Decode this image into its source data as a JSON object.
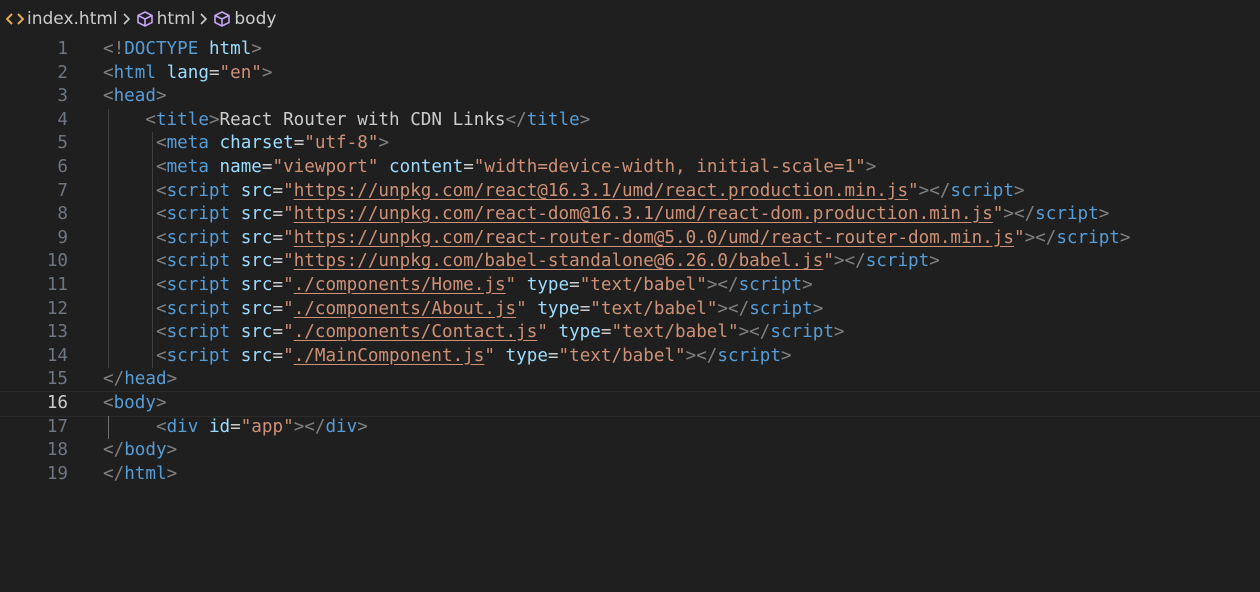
{
  "breadcrumb": {
    "items": [
      {
        "label": "index.html",
        "icon": "code-file-icon"
      },
      {
        "label": "html",
        "icon": "cube-icon"
      },
      {
        "label": "body",
        "icon": "cube-icon"
      }
    ]
  },
  "editor": {
    "active_line": 16,
    "lines": [
      {
        "number": "1",
        "tokens": [
          [
            "p",
            "<!"
          ],
          [
            "t",
            "DOCTYPE"
          ],
          [
            "x",
            " "
          ],
          [
            "a",
            "html"
          ],
          [
            "p",
            ">"
          ]
        ]
      },
      {
        "number": "2",
        "tokens": [
          [
            "p",
            "<"
          ],
          [
            "t",
            "html"
          ],
          [
            "x",
            " "
          ],
          [
            "a",
            "lang"
          ],
          [
            "x",
            "="
          ],
          [
            "s",
            "\"en\""
          ],
          [
            "p",
            ">"
          ]
        ]
      },
      {
        "number": "3",
        "tokens": [
          [
            "p",
            "<"
          ],
          [
            "t",
            "head"
          ],
          [
            "p",
            ">"
          ]
        ]
      },
      {
        "number": "4",
        "tokens": [
          [
            "x",
            "    "
          ],
          [
            "p",
            "<"
          ],
          [
            "t",
            "title"
          ],
          [
            "p",
            ">"
          ],
          [
            "x",
            "React Router with CDN Links"
          ],
          [
            "p",
            "</"
          ],
          [
            "t",
            "title"
          ],
          [
            "p",
            ">"
          ]
        ]
      },
      {
        "number": "5",
        "tokens": [
          [
            "x",
            "     "
          ],
          [
            "p",
            "<"
          ],
          [
            "t",
            "meta"
          ],
          [
            "x",
            " "
          ],
          [
            "a",
            "charset"
          ],
          [
            "x",
            "="
          ],
          [
            "s",
            "\"utf-8\""
          ],
          [
            "p",
            ">"
          ]
        ]
      },
      {
        "number": "6",
        "tokens": [
          [
            "x",
            "     "
          ],
          [
            "p",
            "<"
          ],
          [
            "t",
            "meta"
          ],
          [
            "x",
            " "
          ],
          [
            "a",
            "name"
          ],
          [
            "x",
            "="
          ],
          [
            "s",
            "\"viewport\""
          ],
          [
            "x",
            " "
          ],
          [
            "a",
            "content"
          ],
          [
            "x",
            "="
          ],
          [
            "s",
            "\"width=device-width, initial-scale=1\""
          ],
          [
            "p",
            ">"
          ]
        ]
      },
      {
        "number": "7",
        "tokens": [
          [
            "x",
            "     "
          ],
          [
            "p",
            "<"
          ],
          [
            "t",
            "script"
          ],
          [
            "x",
            " "
          ],
          [
            "a",
            "src"
          ],
          [
            "x",
            "="
          ],
          [
            "s",
            "\""
          ],
          [
            "l",
            "https://unpkg.com/react@16.3.1/umd/react.production.min.js"
          ],
          [
            "s",
            "\""
          ],
          [
            "p",
            "></"
          ],
          [
            "t",
            "script"
          ],
          [
            "p",
            ">"
          ]
        ]
      },
      {
        "number": "8",
        "tokens": [
          [
            "x",
            "     "
          ],
          [
            "p",
            "<"
          ],
          [
            "t",
            "script"
          ],
          [
            "x",
            " "
          ],
          [
            "a",
            "src"
          ],
          [
            "x",
            "="
          ],
          [
            "s",
            "\""
          ],
          [
            "l",
            "https://unpkg.com/react-dom@16.3.1/umd/react-dom.production.min.js"
          ],
          [
            "s",
            "\""
          ],
          [
            "p",
            "></"
          ],
          [
            "t",
            "script"
          ],
          [
            "p",
            ">"
          ]
        ]
      },
      {
        "number": "9",
        "tokens": [
          [
            "x",
            "     "
          ],
          [
            "p",
            "<"
          ],
          [
            "t",
            "script"
          ],
          [
            "x",
            " "
          ],
          [
            "a",
            "src"
          ],
          [
            "x",
            "="
          ],
          [
            "s",
            "\""
          ],
          [
            "l",
            "https://unpkg.com/react-router-dom@5.0.0/umd/react-router-dom.min.js"
          ],
          [
            "s",
            "\""
          ],
          [
            "p",
            "></"
          ],
          [
            "t",
            "script"
          ],
          [
            "p",
            ">"
          ]
        ]
      },
      {
        "number": "10",
        "tokens": [
          [
            "x",
            "     "
          ],
          [
            "p",
            "<"
          ],
          [
            "t",
            "script"
          ],
          [
            "x",
            " "
          ],
          [
            "a",
            "src"
          ],
          [
            "x",
            "="
          ],
          [
            "s",
            "\""
          ],
          [
            "l",
            "https://unpkg.com/babel-standalone@6.26.0/babel.js"
          ],
          [
            "s",
            "\""
          ],
          [
            "p",
            "></"
          ],
          [
            "t",
            "script"
          ],
          [
            "p",
            ">"
          ]
        ]
      },
      {
        "number": "11",
        "tokens": [
          [
            "x",
            "     "
          ],
          [
            "p",
            "<"
          ],
          [
            "t",
            "script"
          ],
          [
            "x",
            " "
          ],
          [
            "a",
            "src"
          ],
          [
            "x",
            "="
          ],
          [
            "s",
            "\""
          ],
          [
            "l",
            "./components/Home.js"
          ],
          [
            "s",
            "\""
          ],
          [
            "x",
            " "
          ],
          [
            "a",
            "type"
          ],
          [
            "x",
            "="
          ],
          [
            "s",
            "\"text/babel\""
          ],
          [
            "p",
            "></"
          ],
          [
            "t",
            "script"
          ],
          [
            "p",
            ">"
          ]
        ]
      },
      {
        "number": "12",
        "tokens": [
          [
            "x",
            "     "
          ],
          [
            "p",
            "<"
          ],
          [
            "t",
            "script"
          ],
          [
            "x",
            " "
          ],
          [
            "a",
            "src"
          ],
          [
            "x",
            "="
          ],
          [
            "s",
            "\""
          ],
          [
            "l",
            "./components/About.js"
          ],
          [
            "s",
            "\""
          ],
          [
            "x",
            " "
          ],
          [
            "a",
            "type"
          ],
          [
            "x",
            "="
          ],
          [
            "s",
            "\"text/babel\""
          ],
          [
            "p",
            "></"
          ],
          [
            "t",
            "script"
          ],
          [
            "p",
            ">"
          ]
        ]
      },
      {
        "number": "13",
        "tokens": [
          [
            "x",
            "     "
          ],
          [
            "p",
            "<"
          ],
          [
            "t",
            "script"
          ],
          [
            "x",
            " "
          ],
          [
            "a",
            "src"
          ],
          [
            "x",
            "="
          ],
          [
            "s",
            "\""
          ],
          [
            "l",
            "./components/Contact.js"
          ],
          [
            "s",
            "\""
          ],
          [
            "x",
            " "
          ],
          [
            "a",
            "type"
          ],
          [
            "x",
            "="
          ],
          [
            "s",
            "\"text/babel\""
          ],
          [
            "p",
            "></"
          ],
          [
            "t",
            "script"
          ],
          [
            "p",
            ">"
          ]
        ]
      },
      {
        "number": "14",
        "tokens": [
          [
            "x",
            "     "
          ],
          [
            "p",
            "<"
          ],
          [
            "t",
            "script"
          ],
          [
            "x",
            " "
          ],
          [
            "a",
            "src"
          ],
          [
            "x",
            "="
          ],
          [
            "s",
            "\""
          ],
          [
            "l",
            "./MainComponent.js"
          ],
          [
            "s",
            "\""
          ],
          [
            "x",
            " "
          ],
          [
            "a",
            "type"
          ],
          [
            "x",
            "="
          ],
          [
            "s",
            "\"text/babel\""
          ],
          [
            "p",
            "></"
          ],
          [
            "t",
            "script"
          ],
          [
            "p",
            ">"
          ]
        ]
      },
      {
        "number": "15",
        "tokens": [
          [
            "p",
            "</"
          ],
          [
            "t",
            "head"
          ],
          [
            "p",
            ">"
          ]
        ]
      },
      {
        "number": "16",
        "tokens": [
          [
            "p",
            "<"
          ],
          [
            "t",
            "body"
          ],
          [
            "p",
            ">"
          ]
        ]
      },
      {
        "number": "17",
        "tokens": [
          [
            "x",
            "     "
          ],
          [
            "p",
            "<"
          ],
          [
            "t",
            "div"
          ],
          [
            "x",
            " "
          ],
          [
            "a",
            "id"
          ],
          [
            "x",
            "="
          ],
          [
            "s",
            "\"app\""
          ],
          [
            "p",
            "></"
          ],
          [
            "t",
            "div"
          ],
          [
            "p",
            ">"
          ]
        ]
      },
      {
        "number": "18",
        "tokens": [
          [
            "p",
            "</"
          ],
          [
            "t",
            "body"
          ],
          [
            "p",
            ">"
          ]
        ]
      },
      {
        "number": "19",
        "tokens": [
          [
            "p",
            "</"
          ],
          [
            "t",
            "html"
          ],
          [
            "p",
            ">"
          ]
        ]
      }
    ]
  },
  "colors": {
    "background": "#1f1f1f",
    "punctuation": "#808080",
    "tag": "#569cd6",
    "attribute": "#9cdcfe",
    "string": "#ce9178",
    "text": "#cccccc",
    "line_number": "#6e7681",
    "breadcrumb_file_icon": "#e8ab53",
    "breadcrumb_symbol_icon": "#c5a5f5"
  }
}
